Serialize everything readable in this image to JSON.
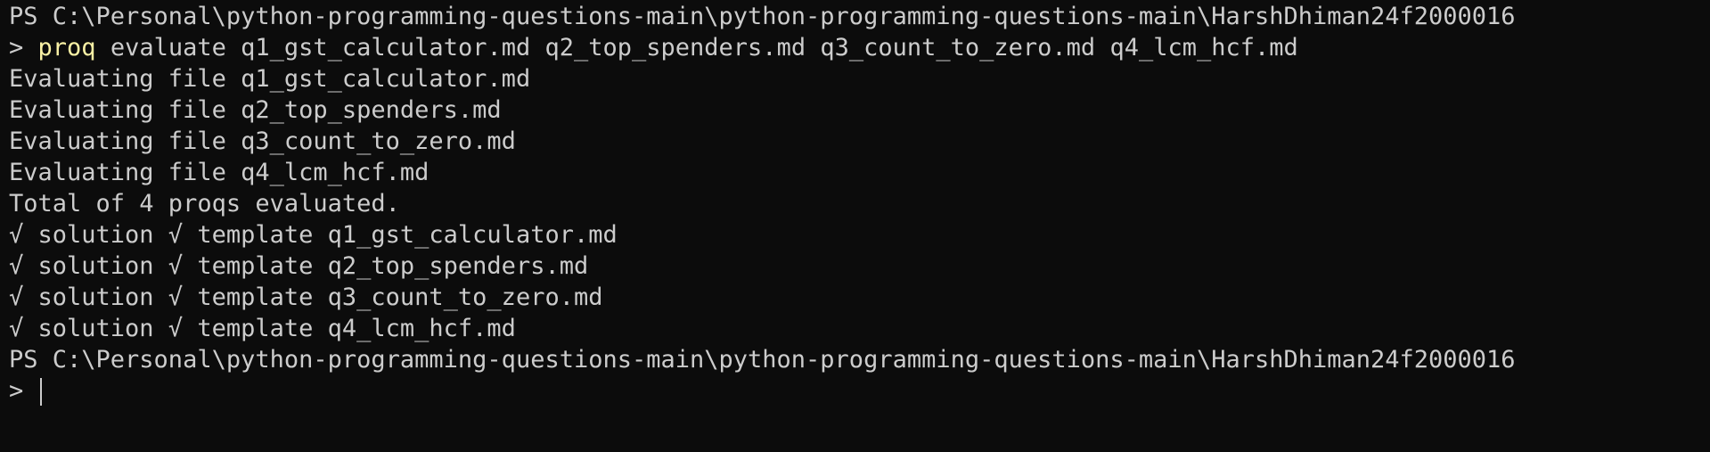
{
  "terminal": {
    "prompt_path": "PS C:\\Personal\\python-programming-questions-main\\python-programming-questions-main\\HarshDhiman24f2000016",
    "prompt_symbol": ">",
    "command": {
      "name": "proq",
      "args": " evaluate q1_gst_calculator.md q2_top_spenders.md q3_count_to_zero.md q4_lcm_hcf.md"
    },
    "output_lines": [
      "Evaluating file q1_gst_calculator.md",
      "Evaluating file q2_top_spenders.md",
      "Evaluating file q3_count_to_zero.md",
      "Evaluating file q4_lcm_hcf.md",
      "Total of 4 proqs evaluated.",
      "√ solution √ template q1_gst_calculator.md",
      "√ solution √ template q2_top_spenders.md",
      "√ solution √ template q3_count_to_zero.md",
      "√ solution √ template q4_lcm_hcf.md"
    ],
    "final_prompt_path": "PS C:\\Personal\\python-programming-questions-main\\python-programming-questions-main\\HarshDhiman24f2000016",
    "final_prompt_symbol": ">"
  }
}
